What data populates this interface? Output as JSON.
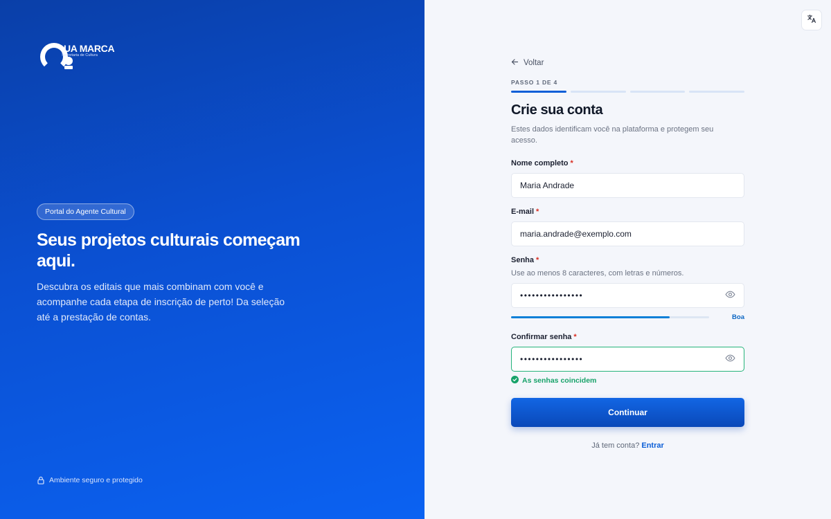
{
  "brand": {
    "name": "UA MARCA",
    "subtitle": "Secretaria de Cultura"
  },
  "hero": {
    "badge": "Portal do Agente Cultural",
    "title": "Seus projetos culturais começam aqui.",
    "description": "Descubra os editais que mais combinam com você e acompanhe cada etapa de inscrição de perto! Da seleção até a prestação de contas.",
    "secure_note": "Ambiente seguro e protegido"
  },
  "toolbar": {
    "language_icon": "translate-icon"
  },
  "form": {
    "back_label": "Voltar",
    "step_label": "PASSO 1 DE 4",
    "current_step": 1,
    "total_steps": 4,
    "title": "Crie sua conta",
    "subtitle": "Estes dados identificam você na plataforma e protegem seu acesso.",
    "fields": {
      "name": {
        "label": "Nome completo",
        "required_mark": "*",
        "value": "Maria Andrade"
      },
      "email": {
        "label": "E-mail",
        "required_mark": "*",
        "value": "maria.andrade@exemplo.com"
      },
      "password": {
        "label": "Senha",
        "required_mark": "*",
        "hint": "Use ao menos 8 caracteres, com letras e números.",
        "value": "••••••••••••••••",
        "strength_label": "Boa",
        "strength_fraction": 0.8
      },
      "confirm": {
        "label": "Confirmar senha",
        "required_mark": "*",
        "value": "••••••••••••••••",
        "match_message": "As senhas coincidem"
      }
    },
    "submit_label": "Continuar",
    "login_prompt": "Já tem conta?",
    "login_link": "Entrar"
  },
  "colors": {
    "primary": "#0b5ed7",
    "success": "#17a269",
    "required": "#d92d20"
  }
}
